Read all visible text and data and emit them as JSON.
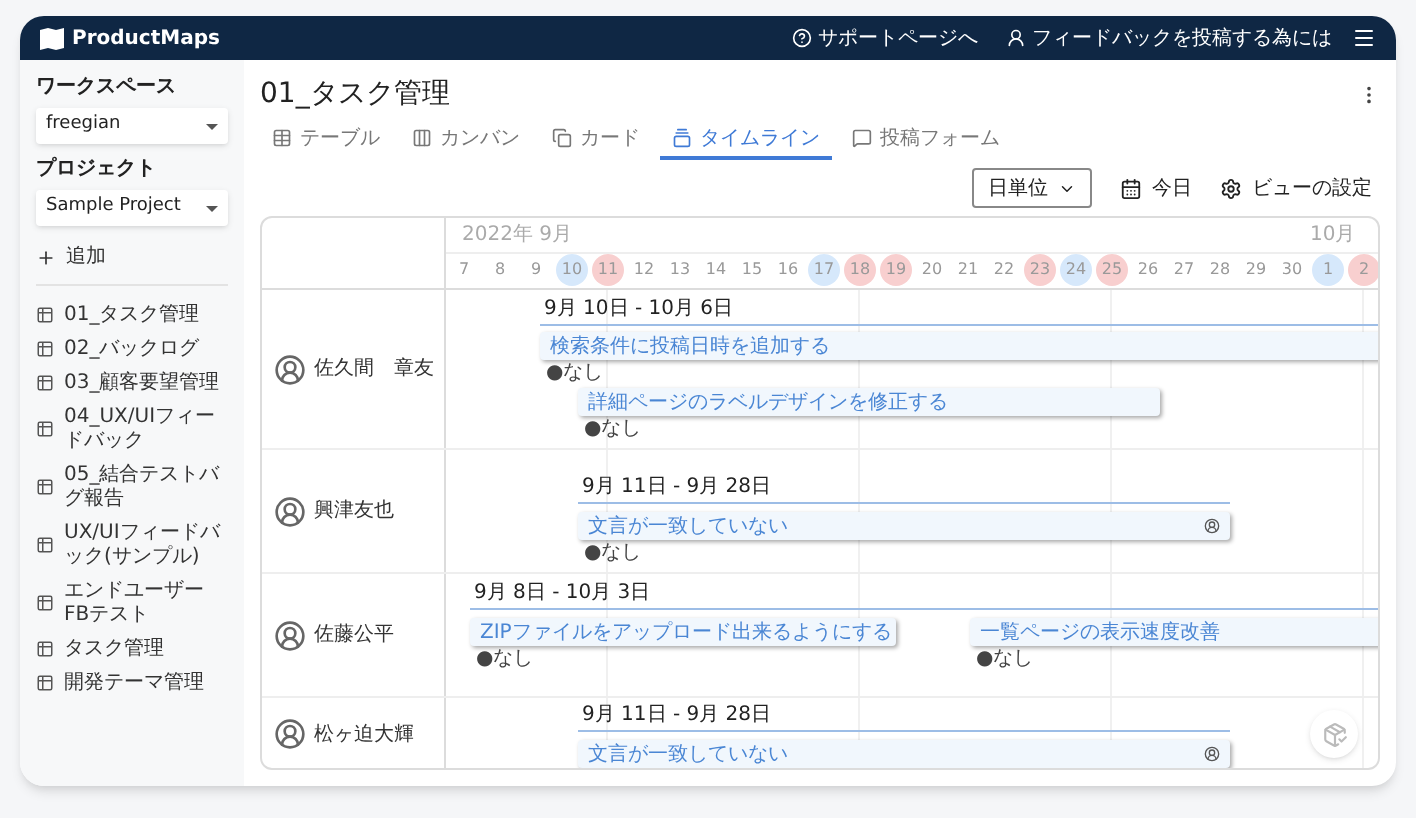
{
  "app": {
    "name": "ProductMaps",
    "links": [
      {
        "label": "サポートページへ",
        "kind": "help"
      },
      {
        "label": "フィードバックを投稿する為には",
        "kind": "feedback"
      }
    ]
  },
  "sidebar": {
    "workspace_label": "ワークスペース",
    "workspace": "freegian",
    "project_label": "プロジェクト",
    "project": "Sample Project",
    "add": "追加",
    "items": [
      "01_タスク管理",
      "02_バックログ",
      "03_顧客要望管理",
      "04_UX/UIフィードバック",
      "05_結合テストバグ報告",
      "UX/UIフィードバック(サンプル)",
      "エンドユーザーFBテスト",
      "タスク管理",
      "開発テーマ管理"
    ]
  },
  "page": {
    "title": "01_タスク管理",
    "tabs": [
      {
        "label": "テーブル",
        "kind": "table",
        "selected": false
      },
      {
        "label": "カンバン",
        "kind": "kanban",
        "selected": false
      },
      {
        "label": "カード",
        "kind": "card",
        "selected": false
      },
      {
        "label": "タイムライン",
        "kind": "timeline",
        "selected": true
      },
      {
        "label": "投稿フォーム",
        "kind": "form",
        "selected": false
      }
    ],
    "toolbar": {
      "scale": "日単位",
      "today": "今日",
      "view_settings": "ビューの設定"
    }
  },
  "timeline": {
    "months": [
      "2022年 9月",
      "10月"
    ],
    "days": [
      {
        "label": "7",
        "kind": "weekday"
      },
      {
        "label": "8",
        "kind": "weekday"
      },
      {
        "label": "9",
        "kind": "weekday"
      },
      {
        "label": "10",
        "kind": "saturday"
      },
      {
        "label": "11",
        "kind": "holiday"
      },
      {
        "label": "12",
        "kind": "weekday"
      },
      {
        "label": "13",
        "kind": "weekday"
      },
      {
        "label": "14",
        "kind": "weekday"
      },
      {
        "label": "15",
        "kind": "weekday"
      },
      {
        "label": "16",
        "kind": "weekday"
      },
      {
        "label": "17",
        "kind": "saturday"
      },
      {
        "label": "18",
        "kind": "holiday"
      },
      {
        "label": "19",
        "kind": "holiday"
      },
      {
        "label": "20",
        "kind": "weekday"
      },
      {
        "label": "21",
        "kind": "weekday"
      },
      {
        "label": "22",
        "kind": "weekday"
      },
      {
        "label": "23",
        "kind": "holiday"
      },
      {
        "label": "24",
        "kind": "saturday"
      },
      {
        "label": "25",
        "kind": "holiday"
      },
      {
        "label": "26",
        "kind": "weekday"
      },
      {
        "label": "27",
        "kind": "weekday"
      },
      {
        "label": "28",
        "kind": "weekday"
      },
      {
        "label": "29",
        "kind": "weekday"
      },
      {
        "label": "30",
        "kind": "weekday"
      },
      {
        "label": "1",
        "kind": "saturday"
      },
      {
        "label": "2",
        "kind": "holiday"
      }
    ],
    "rows": [
      {
        "assignee": "佐久間　章友",
        "range": "9月 10日 - 10月 6日",
        "tasks": [
          {
            "title": "検索条件に投稿日時を追加する",
            "note": "●なし",
            "assignee_icon": false
          },
          {
            "title": "詳細ページのラベルデザインを修正する",
            "note": "●なし",
            "assignee_icon": false
          }
        ]
      },
      {
        "assignee": "興津友也",
        "range": "9月 11日 - 9月 28日",
        "tasks": [
          {
            "title": "文言が一致していない",
            "note": "●なし",
            "assignee_icon": true
          }
        ]
      },
      {
        "assignee": "佐藤公平",
        "range": "9月 8日 - 10月 3日",
        "tasks": [
          {
            "title": "ZIPファイルをアップロード出来るようにする",
            "note": "●なし",
            "assignee_icon": false
          },
          {
            "title": "一覧ページの表示速度改善",
            "note": "●なし",
            "assignee_icon": false
          }
        ]
      },
      {
        "assignee": "松ヶ迫大輝",
        "range": "9月 11日 - 9月 28日",
        "tasks": [
          {
            "title": "文言が一致していない",
            "assignee_icon": true
          }
        ]
      }
    ]
  }
}
